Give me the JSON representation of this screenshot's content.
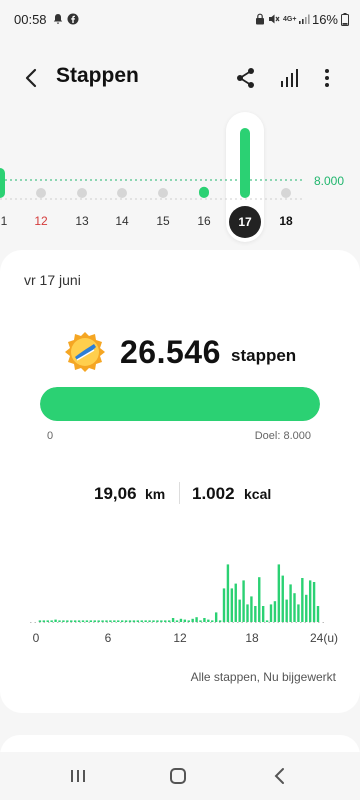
{
  "status_bar": {
    "time": "00:58",
    "battery": "16%",
    "icons": [
      "notification-icon",
      "facebook-icon",
      "lock-icon",
      "mute-icon",
      "4g-icon",
      "signal-icon",
      "battery-icon"
    ]
  },
  "header": {
    "title": "Stappen",
    "icons": [
      "back-icon",
      "share-icon",
      "bar-chart-icon",
      "more-icon"
    ]
  },
  "week_strip": {
    "goal_label": "8.000",
    "days": [
      {
        "label": "1",
        "value_level": 0.33,
        "style": "partial"
      },
      {
        "label": "12",
        "value_level": 0.0,
        "style": "red"
      },
      {
        "label": "13",
        "value_level": 0.05,
        "style": "normal"
      },
      {
        "label": "14",
        "value_level": 0.08,
        "style": "normal"
      },
      {
        "label": "15",
        "value_level": 0.12,
        "style": "normal"
      },
      {
        "label": "16",
        "value_level": 0.17,
        "style": "normal"
      },
      {
        "label": "17",
        "value_level": 1.0,
        "style": "selected"
      },
      {
        "label": "18",
        "value_level": 0.0,
        "style": "bold"
      }
    ]
  },
  "summary": {
    "date": "vr 17 juni",
    "steps": "26.546",
    "steps_unit": "stappen",
    "progress_fraction": 1.0,
    "progress_min": "0",
    "goal_text": "Doel: 8.000",
    "distance": "19,06",
    "distance_unit": "km",
    "calories": "1.002",
    "calories_unit": "kcal",
    "hourly_axis": [
      "0",
      "6",
      "12",
      "18",
      "24(u)"
    ],
    "hourly_levels": [
      0,
      0.02,
      0.02,
      0.02,
      0.02,
      0.03,
      0.02,
      0.02,
      0.02,
      0.02,
      0.02,
      0.02,
      0.02,
      0.02,
      0.02,
      0.02,
      0.02,
      0.02,
      0.02,
      0.02,
      0.02,
      0.02,
      0.02,
      0.02,
      0.02,
      0.02,
      0.02,
      0.02,
      0.02,
      0.02,
      0.02,
      0.02,
      0.02,
      0.02,
      0.02,
      0.05,
      0.02,
      0.04,
      0.03,
      0.02,
      0.04,
      0.06,
      0.02,
      0.05,
      0.03,
      0.02,
      0.12,
      0.02,
      0.42,
      0.72,
      0.42,
      0.48,
      0.28,
      0.52,
      0.22,
      0.32,
      0.2,
      0.56,
      0.2,
      0.02,
      0.22,
      0.26,
      0.72,
      0.58,
      0.28,
      0.47,
      0.36,
      0.22,
      0.55,
      0.34,
      0.52,
      0.5,
      0.2
    ],
    "footnote": "Alle stappen, Nu bijgewerkt"
  },
  "colors": {
    "accent_green": "#2bd173",
    "goal_line_green": "#21b66e",
    "inactive_bar": "#d6d6d6",
    "weekend_red": "#d43b3b"
  },
  "nav_bar": {
    "icons": [
      "recents-icon",
      "home-icon",
      "back-nav-icon"
    ]
  }
}
